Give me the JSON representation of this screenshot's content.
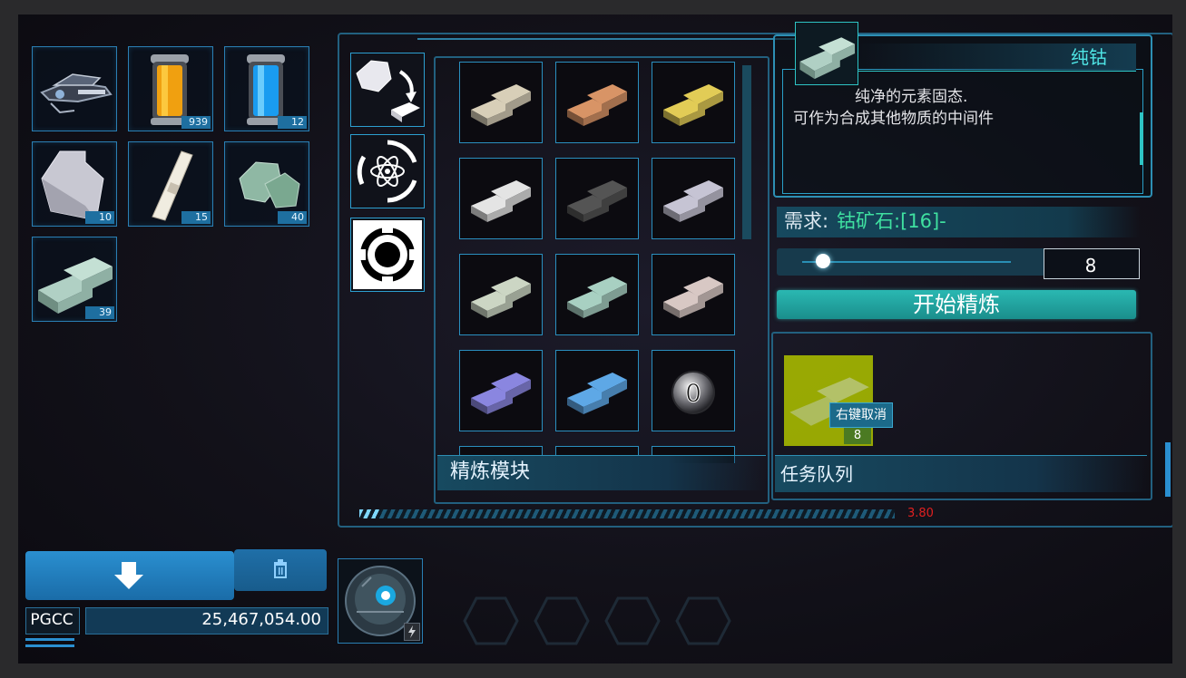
{
  "inventory": {
    "slots": [
      {
        "icon": "drone-icon",
        "count": ""
      },
      {
        "icon": "orange-energy-canister-icon",
        "count": "939"
      },
      {
        "icon": "blue-energy-canister-icon",
        "count": "12"
      },
      {
        "icon": "metal-plate-icon",
        "count": "10"
      },
      {
        "icon": "white-rod-icon",
        "count": "15"
      },
      {
        "icon": "cobalt-ore-icon",
        "count": "40"
      },
      {
        "icon": "cobalt-ingot-icon",
        "count": "39"
      }
    ]
  },
  "bottom_left": {
    "currency_label": "PGCC",
    "currency_value": "25,467,054.00"
  },
  "refine_module": {
    "title": "精炼模块",
    "ingot_colors": [
      "#d8cfb8",
      "#d89466",
      "#e2cc56",
      "#e4e4e4",
      "#545454",
      "#c6c4d4",
      "#ccd6c4",
      "#a8d0c2",
      "#d8c8c4",
      "#8a86e0",
      "#5ea8e6"
    ],
    "last_slot_icon": "zero-orb-icon",
    "last_slot_text": "0"
  },
  "detail": {
    "item_name": "纯钴",
    "description_line1": "纯净的元素固态.",
    "description_line2": "可作为合成其他物质的中间件",
    "requirement_label": "需求:",
    "requirement_value": "钴矿石:[16]-",
    "slider_level": 0.1,
    "quantity": "8",
    "start_button": "开始精炼"
  },
  "queue": {
    "title": "任务队列",
    "tooltip": "右键取消",
    "item_count": "8"
  },
  "bottom_bar": {
    "value": "3.80"
  },
  "colors": {
    "accent": "#2ec4c4",
    "frame": "#2d7fa3",
    "requirement": "#3fe0a0",
    "button": "#1f9e9e",
    "queue_highlight": "#a7b900",
    "red_text": "#e02020"
  }
}
